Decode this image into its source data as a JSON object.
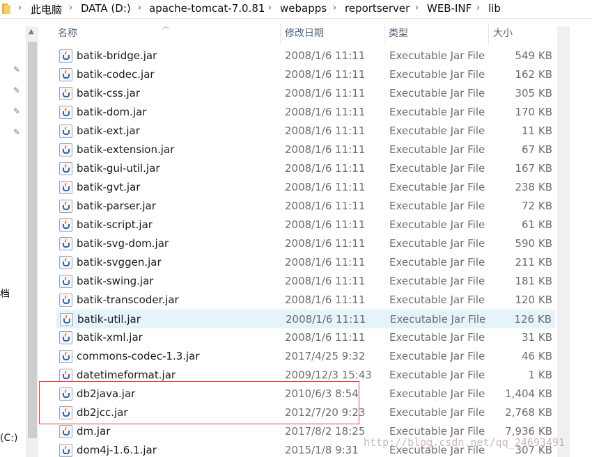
{
  "breadcrumb": [
    "此电脑",
    "DATA (D:)",
    "apache-tomcat-7.0.81",
    "webapps",
    "reportserver",
    "WEB-INF",
    "lib"
  ],
  "nav": {
    "fragment_1": "档",
    "fragment_2": "(C:)"
  },
  "columns": {
    "name": "名称",
    "date": "修改日期",
    "type": "类型",
    "size": "大小"
  },
  "files": [
    {
      "name": "batik-bridge.jar",
      "date": "2008/1/6 11:11",
      "type": "Executable Jar File",
      "size": "549 KB"
    },
    {
      "name": "batik-codec.jar",
      "date": "2008/1/6 11:11",
      "type": "Executable Jar File",
      "size": "162 KB"
    },
    {
      "name": "batik-css.jar",
      "date": "2008/1/6 11:11",
      "type": "Executable Jar File",
      "size": "305 KB"
    },
    {
      "name": "batik-dom.jar",
      "date": "2008/1/6 11:11",
      "type": "Executable Jar File",
      "size": "170 KB"
    },
    {
      "name": "batik-ext.jar",
      "date": "2008/1/6 11:11",
      "type": "Executable Jar File",
      "size": "11 KB"
    },
    {
      "name": "batik-extension.jar",
      "date": "2008/1/6 11:11",
      "type": "Executable Jar File",
      "size": "67 KB"
    },
    {
      "name": "batik-gui-util.jar",
      "date": "2008/1/6 11:11",
      "type": "Executable Jar File",
      "size": "167 KB"
    },
    {
      "name": "batik-gvt.jar",
      "date": "2008/1/6 11:11",
      "type": "Executable Jar File",
      "size": "238 KB"
    },
    {
      "name": "batik-parser.jar",
      "date": "2008/1/6 11:11",
      "type": "Executable Jar File",
      "size": "72 KB"
    },
    {
      "name": "batik-script.jar",
      "date": "2008/1/6 11:11",
      "type": "Executable Jar File",
      "size": "61 KB"
    },
    {
      "name": "batik-svg-dom.jar",
      "date": "2008/1/6 11:11",
      "type": "Executable Jar File",
      "size": "590 KB"
    },
    {
      "name": "batik-svggen.jar",
      "date": "2008/1/6 11:11",
      "type": "Executable Jar File",
      "size": "211 KB"
    },
    {
      "name": "batik-swing.jar",
      "date": "2008/1/6 11:11",
      "type": "Executable Jar File",
      "size": "181 KB"
    },
    {
      "name": "batik-transcoder.jar",
      "date": "2008/1/6 11:11",
      "type": "Executable Jar File",
      "size": "120 KB"
    },
    {
      "name": "batik-util.jar",
      "date": "2008/1/6 11:11",
      "type": "Executable Jar File",
      "size": "126 KB"
    },
    {
      "name": "batik-xml.jar",
      "date": "2008/1/6 11:11",
      "type": "Executable Jar File",
      "size": "31 KB"
    },
    {
      "name": "commons-codec-1.3.jar",
      "date": "2017/4/25 9:32",
      "type": "Executable Jar File",
      "size": "46 KB"
    },
    {
      "name": "datetimeformat.jar",
      "date": "2009/12/3 15:43",
      "type": "Executable Jar File",
      "size": "1 KB"
    },
    {
      "name": "db2java.jar",
      "date": "2010/6/3 8:54",
      "type": "Executable Jar File",
      "size": "1,404 KB"
    },
    {
      "name": "db2jcc.jar",
      "date": "2012/7/20 9:23",
      "type": "Executable Jar File",
      "size": "2,768 KB"
    },
    {
      "name": "dm.jar",
      "date": "2017/8/2 18:25",
      "type": "Executable Jar File",
      "size": "7,936 KB"
    },
    {
      "name": "dom4j-1.6.1.jar",
      "date": "2015/1/8 9:31",
      "type": "Executable Jar File",
      "size": "307 KB"
    }
  ],
  "highlighted_file": "batik-util.jar",
  "watermark": "http://blog.csdn.net/qq_24693491",
  "colors": {
    "highlight": "#e5f3fb",
    "annotation_box": "#e23b3b",
    "header_text": "#4c607a"
  },
  "icons": {
    "folder": "folder-icon",
    "file": "java-jar-icon",
    "pin": "pin-icon"
  }
}
